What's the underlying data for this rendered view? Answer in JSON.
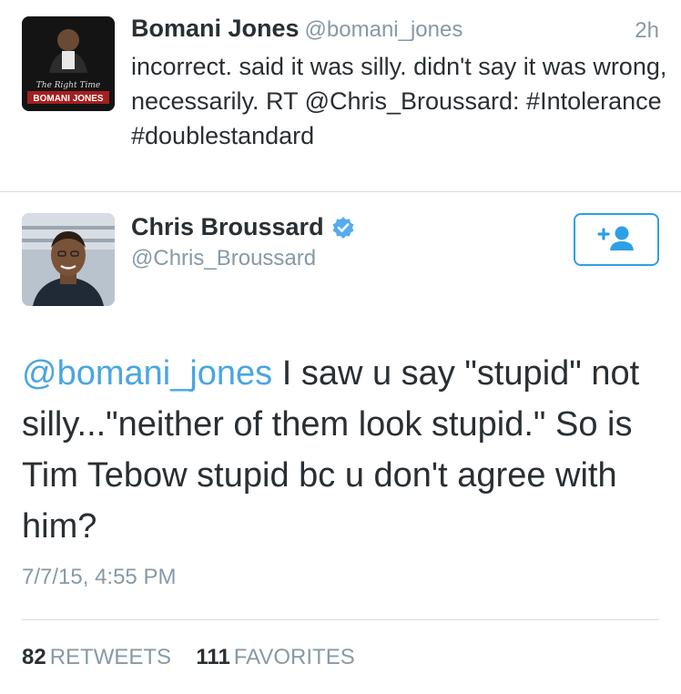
{
  "tweet_parent": {
    "avatar_caption_script": "The Right Time",
    "avatar_caption_name": "BOMANI JONES",
    "name": "Bomani Jones",
    "handle": "@bomani_jones",
    "time": "2h",
    "text": "incorrect. said it was silly. didn't say it was wrong, necessarily. RT @Chris_Broussard: #Intolerance #doublestandard"
  },
  "tweet_main": {
    "name": "Chris Broussard",
    "handle": "@Chris_Broussard",
    "verified_icon": "verified-badge-icon",
    "follow_icon": "add-user-icon",
    "text_mention": "@bomani_jones",
    "text_body": " I saw u say \"stupid\" not silly...\"neither of them look stupid.\" So is Tim Tebow stupid bc u don't agree with him?",
    "date": "7/7/15, 4:55 PM",
    "retweets_count": "82",
    "retweets_label": "RETWEETS",
    "favorites_count": "111",
    "favorites_label": "FAVORITES"
  },
  "colors": {
    "link": "#4aa6e0",
    "muted": "#8899a6",
    "text": "#292f33",
    "button_border": "#2e9fe6"
  }
}
